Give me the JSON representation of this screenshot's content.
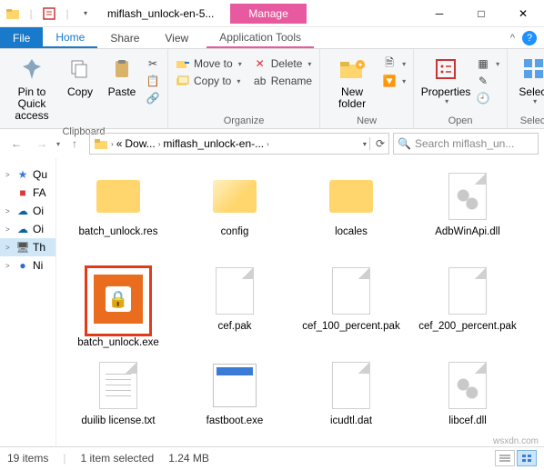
{
  "window": {
    "title": "miflash_unlock-en-5...",
    "context_tab": "Manage",
    "minimize": "─",
    "maximize": "□",
    "close": "✕"
  },
  "ribbon_tabs": {
    "file": "File",
    "home": "Home",
    "share": "Share",
    "view": "View",
    "app_tools": "Application Tools",
    "collapse": "^"
  },
  "ribbon": {
    "clipboard": {
      "label": "Clipboard",
      "pin": "Pin to Quick access",
      "copy": "Copy",
      "paste": "Paste"
    },
    "organize": {
      "label": "Organize",
      "move_to": "Move to",
      "copy_to": "Copy to",
      "delete": "Delete",
      "rename": "Rename"
    },
    "new": {
      "label": "New",
      "new_folder": "New folder"
    },
    "open": {
      "label": "Open",
      "properties": "Properties"
    },
    "select": {
      "label": "Select",
      "select": "Select"
    }
  },
  "breadcrumb": {
    "back": "←",
    "forward": "→",
    "up": "↑",
    "refresh": "⟳",
    "segments": [
      "«",
      "Dow...",
      "miflash_unlock-en-..."
    ],
    "search_placeholder": "Search miflash_un..."
  },
  "sidebar": {
    "items": [
      {
        "icon": "★",
        "label": "Qu",
        "color": "#3a7bd5",
        "exp": ">"
      },
      {
        "icon": "■",
        "label": "FA",
        "color": "#d93a3a",
        "exp": ""
      },
      {
        "icon": "☁",
        "label": "Oi",
        "color": "#0a64a4",
        "exp": ">"
      },
      {
        "icon": "☁",
        "label": "Oi",
        "color": "#0a64a4",
        "exp": ">"
      },
      {
        "icon": "🖥",
        "label": "Th",
        "color": "#555",
        "exp": ">",
        "selected": true
      },
      {
        "icon": "●",
        "label": "Ni",
        "color": "#2b6cd4",
        "exp": ">"
      }
    ]
  },
  "files": [
    {
      "name": "batch_unlock.res",
      "type": "folder"
    },
    {
      "name": "config",
      "type": "folder-open"
    },
    {
      "name": "locales",
      "type": "folder"
    },
    {
      "name": "AdbWinApi.dll",
      "type": "dll"
    },
    {
      "name": "batch_unlock.exe",
      "type": "exe-orange",
      "selected": true
    },
    {
      "name": "cef.pak",
      "type": "file"
    },
    {
      "name": "cef_100_percent.pak",
      "type": "file"
    },
    {
      "name": "cef_200_percent.pak",
      "type": "file"
    },
    {
      "name": "duilib license.txt",
      "type": "txt"
    },
    {
      "name": "fastboot.exe",
      "type": "exe"
    },
    {
      "name": "icudtl.dat",
      "type": "file"
    },
    {
      "name": "libcef.dll",
      "type": "dll"
    }
  ],
  "status": {
    "count": "19 items",
    "selection": "1 item selected",
    "size": "1.24 MB"
  },
  "watermark": "wsxdn.com"
}
